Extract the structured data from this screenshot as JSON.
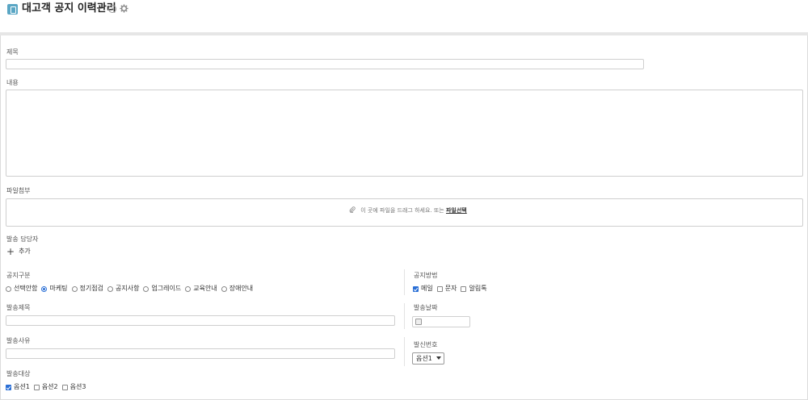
{
  "header": {
    "title": "대고객 공지 이력관리",
    "icons": [
      "document-icon",
      "info-icon",
      "gear-icon"
    ]
  },
  "form": {
    "subject_label": "제목",
    "subject_value": "",
    "content_label": "내용",
    "content_value": "",
    "attach_label": "파일첨부",
    "attach_hint": "이 곳에 파일을 드래그 하세요. 또는",
    "attach_link": "파일선택",
    "sender_label": "발송 담당자",
    "add_label": "추가",
    "notice_type": {
      "label": "공지구분",
      "options": [
        {
          "label": "선택안함",
          "selected": false
        },
        {
          "label": "마케팅",
          "selected": true
        },
        {
          "label": "정기점검",
          "selected": false
        },
        {
          "label": "공지사항",
          "selected": false
        },
        {
          "label": "업그레이드",
          "selected": false
        },
        {
          "label": "교육안내",
          "selected": false
        },
        {
          "label": "장애안내",
          "selected": false
        }
      ]
    },
    "notice_method": {
      "label": "공지방법",
      "options": [
        {
          "label": "메일",
          "checked": true
        },
        {
          "label": "문자",
          "checked": false
        },
        {
          "label": "알림톡",
          "checked": false
        }
      ]
    },
    "send_subject_label": "발송제목",
    "send_subject_value": "",
    "send_date_label": "발송날짜",
    "send_date_value": "",
    "send_reason_label": "발송사유",
    "send_reason_value": "",
    "caller_number_label": "발신번호",
    "caller_number_selected": "옵션1",
    "target": {
      "label": "발송대상",
      "options": [
        {
          "label": "옵션1",
          "checked": true
        },
        {
          "label": "옵션2",
          "checked": false
        },
        {
          "label": "옵션3",
          "checked": false
        }
      ]
    }
  },
  "colors": {
    "accent": "#2a6fd6",
    "app_icon": "#5aa6c4",
    "border": "#cfcfcf"
  }
}
